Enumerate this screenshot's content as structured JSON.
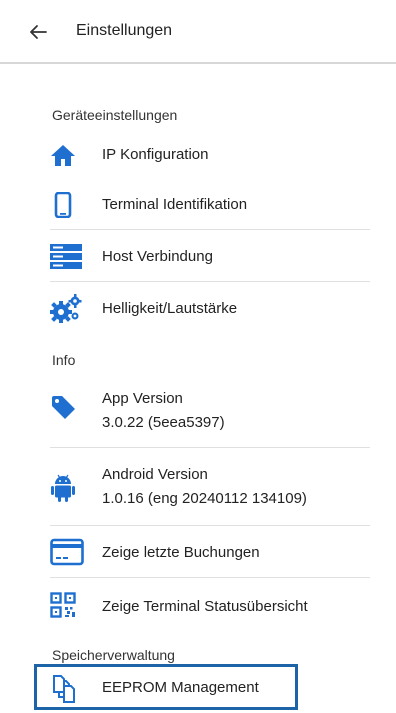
{
  "header": {
    "title": "Einstellungen",
    "back_icon": "arrow-left-icon"
  },
  "sections": {
    "device": "Geräteeinstellungen",
    "info": "Info",
    "storage": "Speicherverwaltung"
  },
  "items": {
    "ip": {
      "label": "IP Konfiguration",
      "icon": "home-icon"
    },
    "terminal": {
      "label": "Terminal Identifikation",
      "icon": "smartphone-icon"
    },
    "host": {
      "label": "Host Verbindung",
      "icon": "server-icon"
    },
    "brightness": {
      "label": "Helligkeit/Lautstärke",
      "icon": "gears-icon"
    },
    "app": {
      "label": "App Version",
      "value": "3.0.22 (5eea5397)",
      "icon": "tag-icon"
    },
    "android": {
      "label": "Android Version",
      "value": "1.0.16 (eng 20240112 134109)",
      "icon": "android-icon"
    },
    "bookings": {
      "label": "Zeige letzte Buchungen",
      "icon": "credit-card-icon"
    },
    "status": {
      "label": "Zeige Terminal Statusübersicht",
      "icon": "qr-code-icon"
    },
    "eeprom": {
      "label": "EEPROM Management",
      "icon": "copy-icon"
    }
  },
  "colors": {
    "accent": "#1e6fd0",
    "highlight": "#1d63a7",
    "divider": "#e0e0e0"
  }
}
